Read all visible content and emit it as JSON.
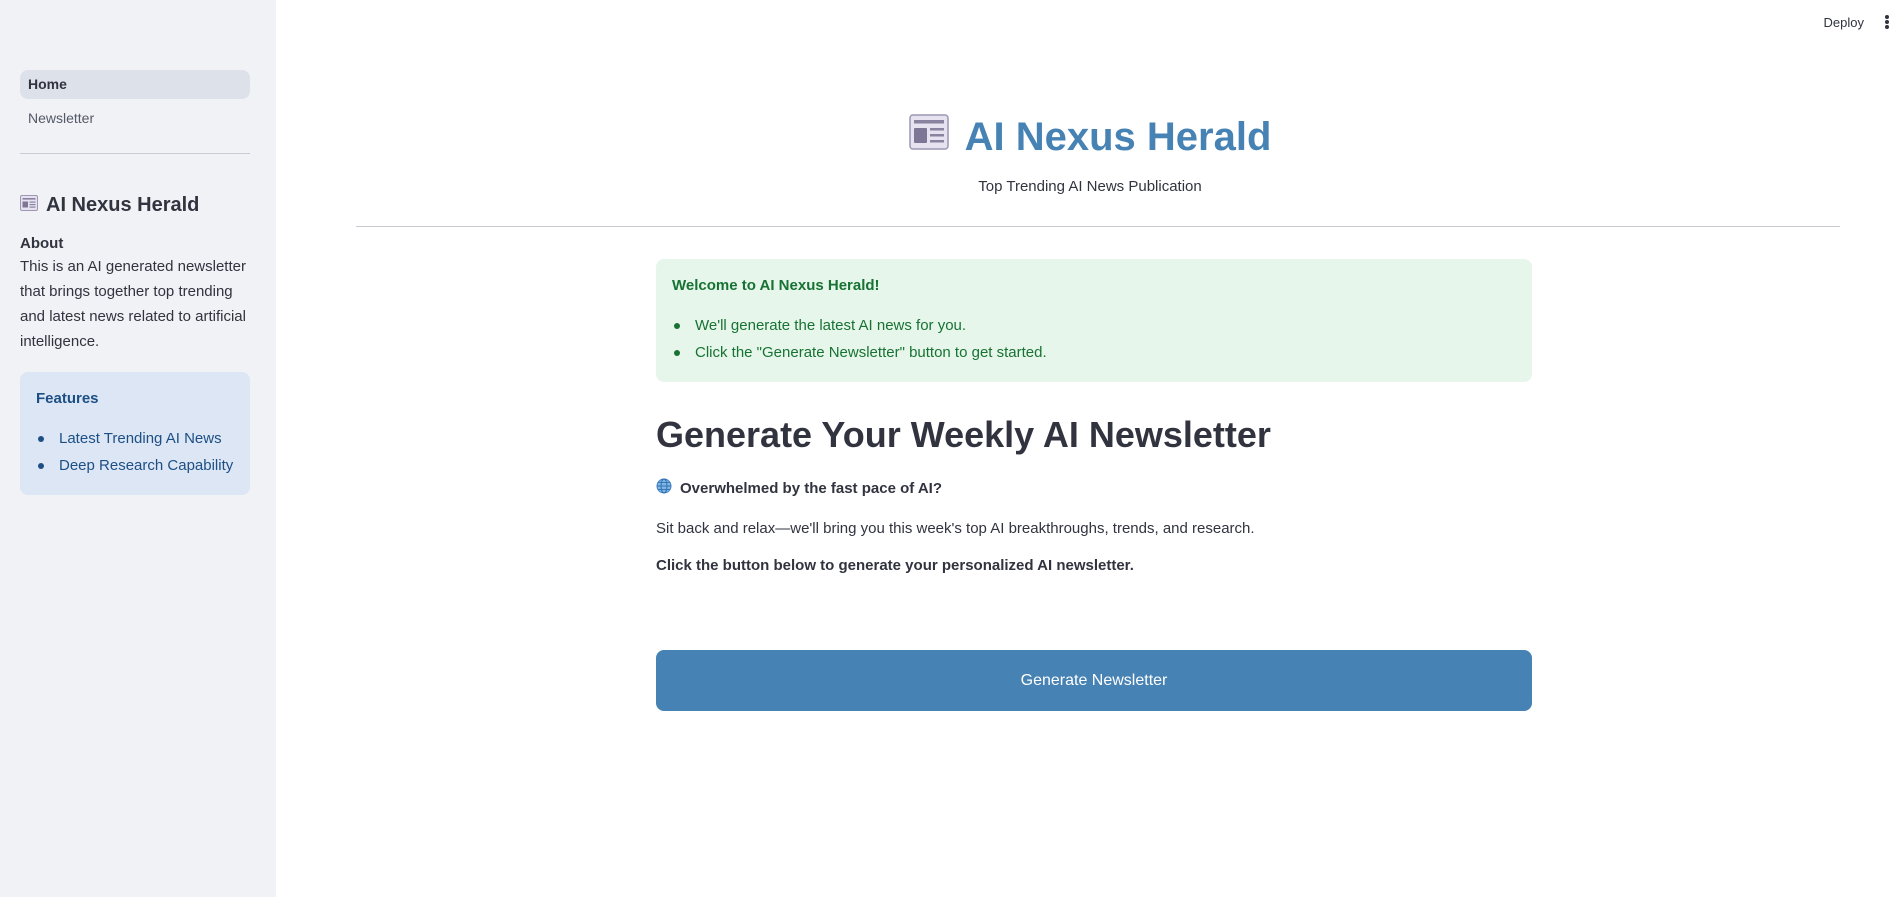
{
  "topbar": {
    "deploy_label": "Deploy"
  },
  "sidebar": {
    "nav": [
      {
        "label": "Home",
        "active": true
      },
      {
        "label": "Newsletter",
        "active": false
      }
    ],
    "brand": "AI Nexus Herald",
    "about_title": "About",
    "about_text": "This is an AI generated newsletter that brings together top trending and latest news related to artificial intelligence.",
    "features_title": "Features",
    "features": [
      "Latest Trending AI News",
      "Deep Research Capability"
    ]
  },
  "hero": {
    "title": "AI Nexus Herald",
    "subtitle": "Top Trending AI News Publication"
  },
  "welcome": {
    "title": "Welcome to AI Nexus Herald!",
    "items": [
      "We'll generate the latest AI news for you.",
      "Click the \"Generate Newsletter\" button to get started."
    ]
  },
  "main": {
    "section_title": "Generate Your Weekly AI Newsletter",
    "overwhelm": "Overwhelmed by the fast pace of AI?",
    "relax": "Sit back and relax—we'll bring you this week's top AI breakthroughs, trends, and research.",
    "click": "Click the button below to generate your personalized AI newsletter.",
    "button_label": "Generate Newsletter"
  },
  "icons": {
    "brand": "newspaper-icon",
    "overwhelm": "globe-icon",
    "menu": "kebab-menu-icon"
  },
  "colors": {
    "accent": "#4682b4",
    "sidebar_bg": "#f0f2f6",
    "success_bg": "#e6f6ea",
    "success_text": "#177233",
    "info_bg": "#dce6f4",
    "info_text": "#1d4f85"
  }
}
